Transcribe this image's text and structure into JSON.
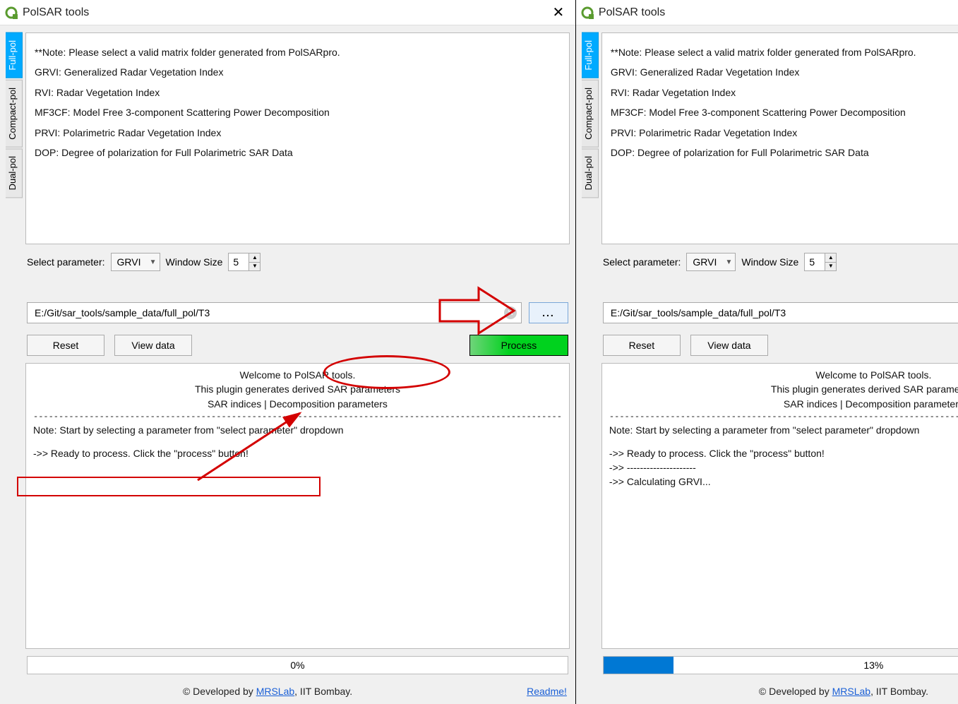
{
  "title": "PolSAR tools",
  "tabs": [
    "Full-pol",
    "Compact-pol",
    "Dual-pol"
  ],
  "info": {
    "note": "**Note: Please select a valid matrix folder generated from PolSARpro.",
    "grvi": "GRVI: Generalized Radar Vegetation Index",
    "rvi": "RVI: Radar Vegetation Index",
    "mf3cf": "MF3CF: Model Free 3-component Scattering Power Decomposition",
    "prvi": "PRVI: Polarimetric Radar Vegetation Index",
    "dop": "DOP: Degree of polarization for Full Polarimetric SAR Data"
  },
  "param": {
    "label": "Select parameter:",
    "value": "GRVI",
    "ws_label": "Window Size",
    "ws_value": "5"
  },
  "path": "E:/Git/sar_tools/sample_data/full_pol/T3",
  "buttons": {
    "reset": "Reset",
    "view": "View data",
    "process": "Process",
    "browse": "..."
  },
  "log": {
    "welcome1": "Welcome to PolSAR tools.",
    "welcome2": "This plugin generates derived SAR parameters",
    "welcome3": "SAR indices | Decomposition parameters",
    "note": "Note: Start by selecting a parameter from \"select parameter\" dropdown",
    "ready": "->> Ready to process. Click the \"process\" button!",
    "dash": "->> ---------------------",
    "calc": "->> Calculating GRVI..."
  },
  "progress": {
    "left": "0%",
    "right": "13%",
    "right_pct": 13
  },
  "footer": {
    "prefix": "© Developed by ",
    "link": "MRSLab",
    "suffix": ", IIT Bombay.",
    "readme": "Readme!"
  }
}
